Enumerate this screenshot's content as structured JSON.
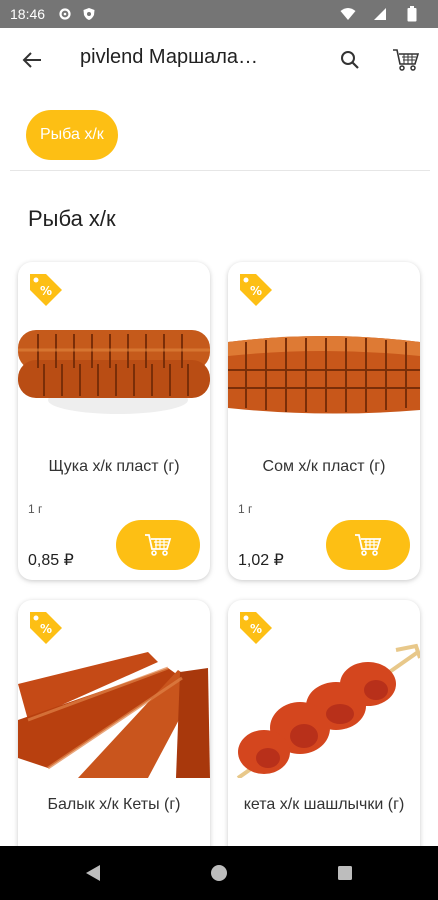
{
  "status_bar": {
    "time": "18:46"
  },
  "app_bar": {
    "title": "pivlend Маршала…"
  },
  "filter": {
    "chip_label": "Рыба х/к"
  },
  "section": {
    "title": "Рыба х/к"
  },
  "products": [
    {
      "name": "Щука х/к пласт (г)",
      "unit": "1 г",
      "price": "0,85 ₽"
    },
    {
      "name": "Сом х/к пласт (г)",
      "unit": "1 г",
      "price": "1,02 ₽"
    },
    {
      "name": "Балык х/к Кеты (г)",
      "unit": "",
      "price": ""
    },
    {
      "name": "кета х/к шашлычки (г)",
      "unit": "",
      "price": ""
    }
  ],
  "colors": {
    "accent": "#fdbf14",
    "status_bar": "#757575",
    "nav_bar": "#000000"
  },
  "icons": [
    "back-arrow-icon",
    "search-icon",
    "cart-icon",
    "discount-tag-icon",
    "add-to-cart-icon",
    "nav-back-icon",
    "nav-home-icon",
    "nav-recents-icon"
  ]
}
